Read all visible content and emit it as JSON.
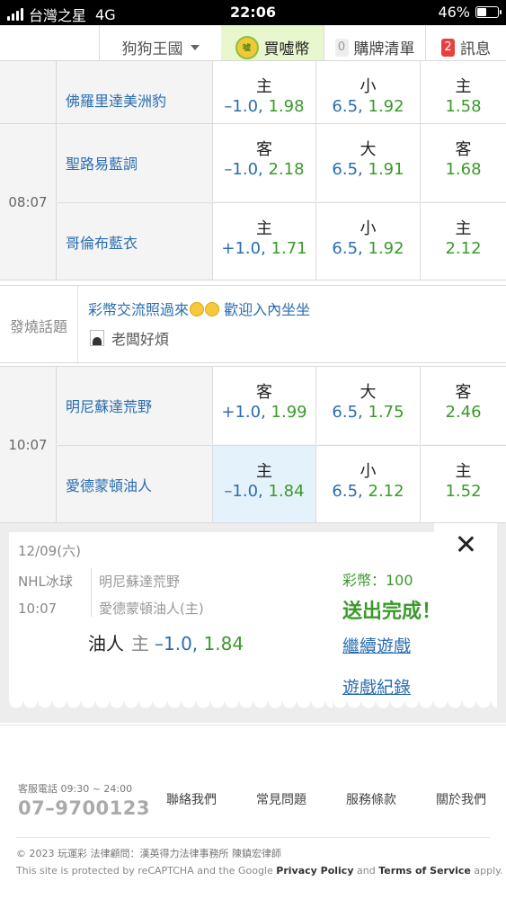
{
  "status_bar": {
    "carrier": "台灣之星",
    "network": "4G",
    "time": "22:06",
    "battery": "46%",
    "battery_level": 0.46
  },
  "nav": {
    "kingdom": "狗狗王國",
    "buy_coin_icon": "噓",
    "buy_coin": "買噓幣",
    "cart_count": "0",
    "cart": "購牌清單",
    "msg_count": "2",
    "messages": "訊息"
  },
  "games": [
    {
      "time": "",
      "rows": [
        {
          "team": "佛羅里達美洲豹",
          "spread_label": "主",
          "spread": "–1.0,",
          "spread_odds": "1.98",
          "total_label": "小",
          "total": "6.5,",
          "total_odds": "1.92",
          "ml_label": "主",
          "ml_odds": "1.58"
        }
      ]
    },
    {
      "time": "08:07",
      "rows": [
        {
          "team": "聖路易藍調",
          "spread_label": "客",
          "spread": "–1.0,",
          "spread_odds": "2.18",
          "total_label": "大",
          "total": "6.5,",
          "total_odds": "1.91",
          "ml_label": "客",
          "ml_odds": "1.68"
        },
        {
          "team": "哥倫布藍衣",
          "spread_label": "主",
          "spread": "+1.0,",
          "spread_odds": "1.71",
          "total_label": "小",
          "total": "6.5,",
          "total_odds": "1.92",
          "ml_label": "主",
          "ml_odds": "2.12"
        }
      ]
    },
    {
      "time": "10:07",
      "rows": [
        {
          "team": "明尼蘇達荒野",
          "spread_label": "客",
          "spread": "+1.0,",
          "spread_odds": "1.99",
          "total_label": "大",
          "total": "6.5,",
          "total_odds": "1.75",
          "ml_label": "客",
          "ml_odds": "2.46"
        },
        {
          "team": "愛德蒙頓油人",
          "spread_label": "主",
          "spread": "–1.0,",
          "spread_odds": "1.84",
          "total_label": "小",
          "total": "6.5,",
          "total_odds": "2.12",
          "ml_label": "主",
          "ml_odds": "1.52"
        }
      ]
    }
  ],
  "hot_topic": {
    "label": "發燒話題",
    "line1": "彩幣交流照過來",
    "line1_suffix": "歡迎入內坐坐",
    "line2": "老闆好煩"
  },
  "receipt": {
    "date": "12/09(六)",
    "sport": "NHL冰球",
    "time": "10:07",
    "away": "明尼蘇達荒野",
    "home": "愛德蒙頓油人(主)",
    "bet_team": "油人",
    "bet_side": "主",
    "bet_spread": "–1.0,",
    "bet_odds": "1.84"
  },
  "result": {
    "coins": "彩幣：100",
    "done": "送出完成！",
    "continue": "繼續遊戲",
    "history": "遊戲紀錄"
  },
  "footer": {
    "cs_label": "客服電話 09:30 ~ 24:00",
    "cs_phone": "07–9700123",
    "links": [
      "聯絡我們",
      "常見問題",
      "服務條款",
      "關於我們"
    ],
    "copyright": "© 2023 玩運彩 法律顧問：漢英得力法律事務所 陳鎮宏律師",
    "recaptcha_prefix": "This site is protected by reCAPTCHA and the Google",
    "privacy": "Privacy Policy",
    "and": "and",
    "terms": "Terms of Service",
    "apply": "apply."
  }
}
